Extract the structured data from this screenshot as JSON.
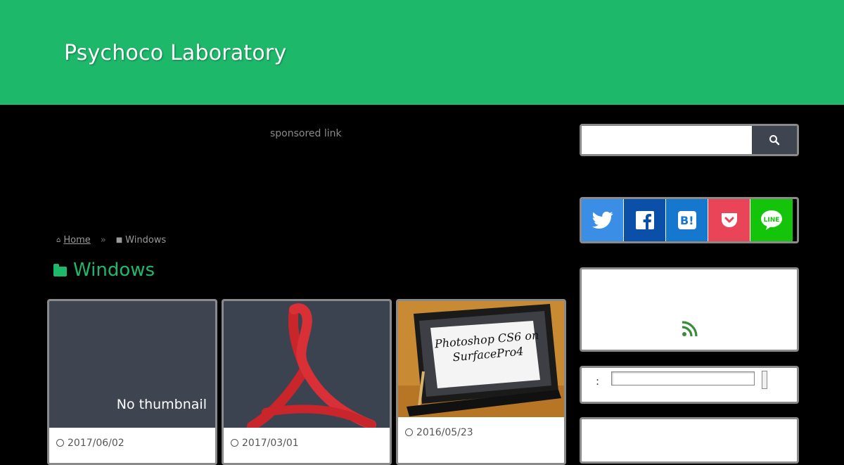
{
  "header": {
    "site_title": "Psychoco Laboratory",
    "bg_color": "#1db86a"
  },
  "ad": {
    "label": "sponsored link"
  },
  "breadcrumb": {
    "home_label": "Home",
    "separator": "»",
    "current_label": "Windows"
  },
  "page": {
    "title": "Windows",
    "accent_color": "#1db86a"
  },
  "cards": [
    {
      "thumbnail_text": "No thumbnail",
      "date": "2017/06/02"
    },
    {
      "thumbnail_text": "",
      "date": "2017/03/01"
    },
    {
      "thumbnail_text": "Photoshop CS6 on SurfacePro4",
      "date": "2016/05/23"
    }
  ],
  "sidebar": {
    "search": {
      "placeholder": "",
      "button_icon": "search-icon"
    },
    "share_buttons": [
      {
        "icon": "twitter-icon",
        "color": "#3a8ee6"
      },
      {
        "icon": "facebook-icon",
        "color": "#0a4fa8"
      },
      {
        "icon": "hatena-bookmark-icon",
        "color": "#1677cf"
      },
      {
        "icon": "pocket-icon",
        "color": "#ea4459"
      },
      {
        "icon": "line-icon",
        "color": "#14c40a"
      }
    ],
    "feed": {
      "icon": "rss-icon",
      "color": "#3a8c3a"
    },
    "form": {
      "label": ":"
    }
  }
}
